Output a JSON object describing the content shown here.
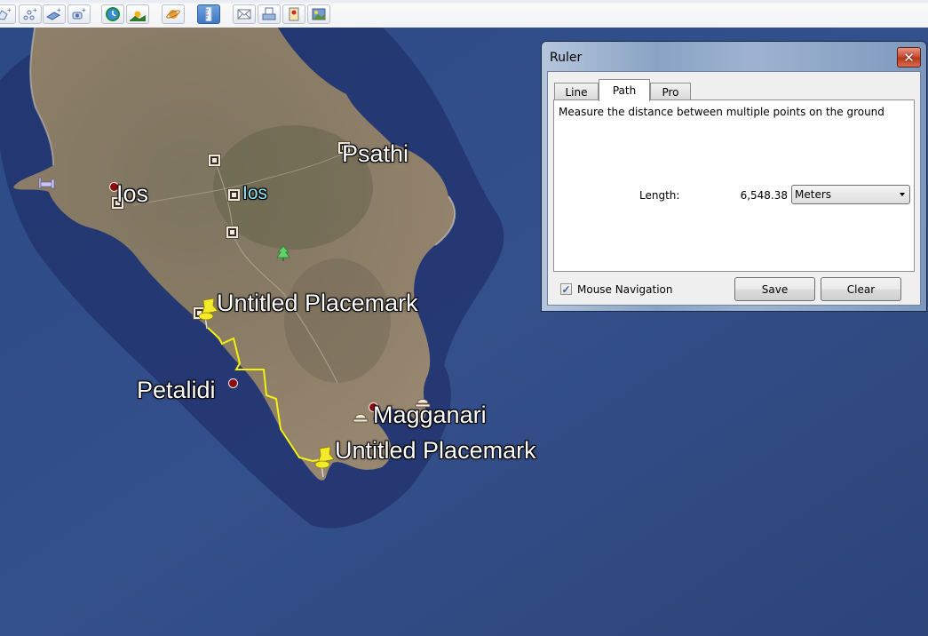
{
  "toolbar": {
    "buttons": [
      {
        "name": "add-polygon-button",
        "icon": "polygon-plus-icon"
      },
      {
        "name": "add-path-button",
        "icon": "path-plus-icon"
      },
      {
        "name": "add-image-overlay-button",
        "icon": "image-overlay-plus-icon"
      },
      {
        "name": "record-tour-button",
        "icon": "camera-plus-icon"
      },
      {
        "name": "historical-imagery-button",
        "icon": "clock-icon"
      },
      {
        "name": "sunlight-button",
        "icon": "sun-landscape-icon"
      },
      {
        "name": "switch-planet-button",
        "icon": "planet-icon"
      },
      {
        "name": "ruler-button",
        "icon": "ruler-icon",
        "active": true
      },
      {
        "name": "email-button",
        "icon": "envelope-icon"
      },
      {
        "name": "print-button",
        "icon": "printer-icon"
      },
      {
        "name": "view-in-maps-button",
        "icon": "map-pin-icon"
      },
      {
        "name": "save-image-button",
        "icon": "image-icon"
      }
    ]
  },
  "map": {
    "labels": {
      "psathi": "Psathi",
      "ios_town": "Ios",
      "ios_island": "Ios",
      "placemark_north": "Untitled Placemark",
      "petalidi": "Petalidi",
      "magganari": "Magganari",
      "placemark_south": "Untitled Placemark"
    },
    "path_color": "#f2f20a"
  },
  "ruler": {
    "title": "Ruler",
    "close_label": "✕",
    "tabs": [
      {
        "label": "Line",
        "selected": false
      },
      {
        "label": "Path",
        "selected": true
      },
      {
        "label": "Pro",
        "selected": false
      }
    ],
    "description": "Measure the distance between multiple points on the ground",
    "length_label": "Length:",
    "length_value": "6,548.38",
    "unit": "Meters",
    "mouse_navigation_label": "Mouse Navigation",
    "mouse_navigation_checked": true,
    "checkmark": "✓",
    "save_label": "Save",
    "clear_label": "Clear"
  }
}
